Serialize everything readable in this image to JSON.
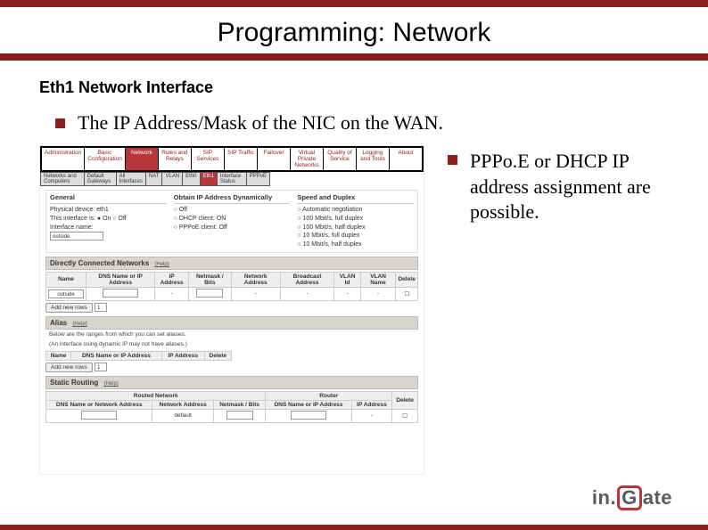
{
  "slide": {
    "title": "Programming: Network",
    "subheading": "Eth1 Network Interface",
    "bullet1": "The IP Address/Mask of the NIC on the WAN.",
    "bullet2": "PPPo.E or DHCP IP address assignment are possible."
  },
  "tabs_top": [
    {
      "label": "Administration"
    },
    {
      "label": "Basic Configuration"
    },
    {
      "label": "Network"
    },
    {
      "label": "Rules and Relays"
    },
    {
      "label": "SIP Services"
    },
    {
      "label": "SIP Traffic"
    },
    {
      "label": "Failover"
    },
    {
      "label": "Virtual Private Networks"
    },
    {
      "label": "Quality of Service"
    },
    {
      "label": "Logging and Tools"
    },
    {
      "label": "About"
    }
  ],
  "tabs_sub": [
    {
      "label": "Networks and Computers"
    },
    {
      "label": "Default Gateways"
    },
    {
      "label": "All Interfaces"
    },
    {
      "label": "NAT"
    },
    {
      "label": "VLAN"
    },
    {
      "label": "Eth0"
    },
    {
      "label": "Eth1"
    },
    {
      "label": "Interface Status"
    },
    {
      "label": "PPPoE"
    }
  ],
  "active_top": "Network",
  "active_sub": "Eth1",
  "general": {
    "title": "General",
    "phys": "Physical device: eth1",
    "iface_toggle": "This interface is:  ● On  ○ Off",
    "iface_name_label": "Interface name:",
    "iface_name_value": "outside"
  },
  "obtain": {
    "title": "Obtain IP Address Dynamically",
    "opt1": "Off",
    "opt2": "DHCP client: ON",
    "opt3": "PPPoE client: Off"
  },
  "speed": {
    "title": "Speed and Duplex",
    "o1": "Automatic negotiation",
    "o2": "100 Mbit/s, full duplex",
    "o3": "100 Mbit/s, half duplex",
    "o4": "10 Mbit/s, full duplex",
    "o5": "10 Mbit/s, half duplex"
  },
  "dcn": {
    "title": "Directly Connected Networks",
    "help": "(Help)",
    "cols": [
      "Name",
      "DNS Name or IP Address",
      "IP Address",
      "Netmask / Bits",
      "Network Address",
      "Broadcast Address",
      "VLAN Id",
      "VLAN Name",
      "Delete"
    ],
    "row1_name": "outside"
  },
  "alias": {
    "title": "Alias",
    "help": "(Help)",
    "note": "Below are the ranges from which you can set aliases.",
    "note2": "(An interface using dynamic IP may not have aliases.)",
    "cols": [
      "Name",
      "DNS Name or IP Address",
      "IP Address",
      "Delete"
    ]
  },
  "static": {
    "title": "Static Routing",
    "help": "(Help)",
    "router_hdr": "Router",
    "routed_hdr": "Routed Network",
    "cols": [
      "DNS Name or Network Address",
      "Network Address",
      "Netmask / Bits",
      "DNS Name or IP Address",
      "IP Address",
      "Delete"
    ],
    "row_def": "default"
  },
  "buttons": {
    "add_rows": "Add new rows",
    "count": "1"
  },
  "logo": {
    "pre": "in.",
    "g": "G",
    "post": "ate"
  }
}
